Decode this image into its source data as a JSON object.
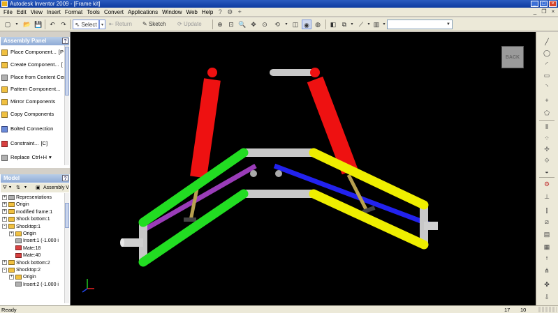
{
  "window": {
    "title": "Autodesk Inventor 2009 - [Frame kit]"
  },
  "menu": {
    "items": [
      "File",
      "Edit",
      "View",
      "Insert",
      "Format",
      "Tools",
      "Convert",
      "Applications",
      "Window",
      "Web",
      "Help"
    ]
  },
  "toolbar": {
    "select_label": "Select",
    "return_label": "Return",
    "sketch_label": "Sketch",
    "update_label": "Update",
    "combo_value": ""
  },
  "assembly_panel": {
    "title": "Assembly Panel",
    "items": [
      {
        "label": "Place Component...",
        "shortcut": "[P"
      },
      {
        "label": "Create Component...",
        "shortcut": "["
      },
      {
        "label": "Place from Content Cen",
        "shortcut": ""
      },
      {
        "label": "Pattern Component...",
        "shortcut": ""
      },
      {
        "label": "Mirror Components",
        "shortcut": ""
      },
      {
        "label": "Copy Components",
        "shortcut": ""
      },
      {
        "label": "Bolted Connection",
        "shortcut": ""
      },
      {
        "label": "Constraint...",
        "shortcut": "[C]"
      },
      {
        "label": "Replace",
        "shortcut": "Ctrl+H"
      }
    ]
  },
  "model_panel": {
    "title": "Model",
    "view_label": "Assembly V",
    "tree": [
      {
        "label": "Representations",
        "level": 0,
        "expander": "+",
        "icon": "gray"
      },
      {
        "label": "Origin",
        "level": 0,
        "expander": "+",
        "icon": "folder"
      },
      {
        "label": "modified frame:1",
        "level": 0,
        "expander": "+",
        "icon": "folder"
      },
      {
        "label": "Shock bottom:1",
        "level": 0,
        "expander": "+",
        "icon": "folder"
      },
      {
        "label": "Shocktop:1",
        "level": 0,
        "expander": "-",
        "icon": "folder"
      },
      {
        "label": "Origin",
        "level": 1,
        "expander": "+",
        "icon": "folder"
      },
      {
        "label": "Insert:1 (-1.000 i",
        "level": 1,
        "expander": "",
        "icon": "gray"
      },
      {
        "label": "Mate:18",
        "level": 1,
        "expander": "",
        "icon": "red"
      },
      {
        "label": "Mate:40",
        "level": 1,
        "expander": "",
        "icon": "red"
      },
      {
        "label": "Shock bottom:2",
        "level": 0,
        "expander": "+",
        "icon": "folder"
      },
      {
        "label": "Shocktop:2",
        "level": 0,
        "expander": "-",
        "icon": "folder"
      },
      {
        "label": "Origin",
        "level": 1,
        "expander": "+",
        "icon": "folder"
      },
      {
        "label": "Insert:2 (-1.000 i",
        "level": 1,
        "expander": "",
        "icon": "gray"
      }
    ]
  },
  "viewcube": {
    "label": "BACK"
  },
  "status": {
    "left": "Ready",
    "num1": "17",
    "num2": "10"
  },
  "colors": {
    "frame_green": "#22dd22",
    "frame_yellow": "#eeee00",
    "shock_red": "#ee1111",
    "rod_purple": "#9a3cb8",
    "rod_blue": "#2222ee",
    "frame_gray": "#c8c8c8"
  }
}
